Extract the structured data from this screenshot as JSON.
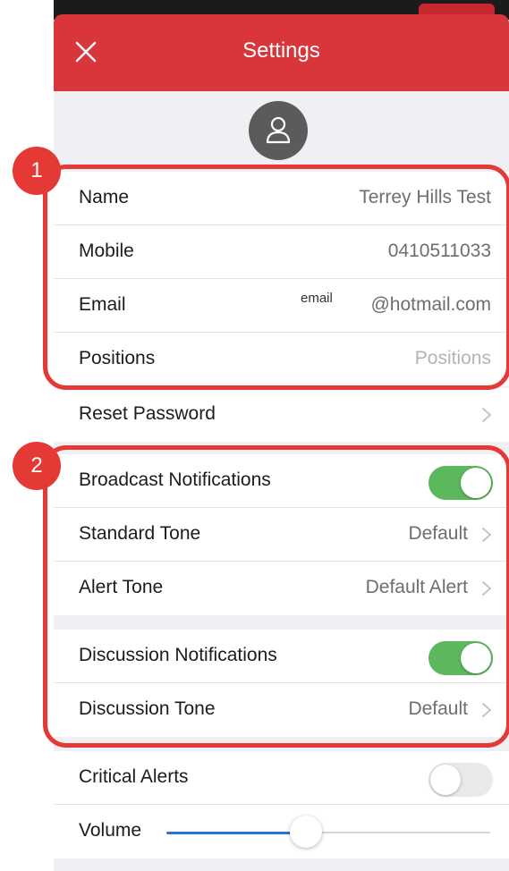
{
  "header": {
    "title": "Settings",
    "close_icon": "close-icon"
  },
  "profile": {
    "avatar_icon": "user-avatar-icon",
    "rows": [
      {
        "label": "Name",
        "value": "Terrey Hills Test"
      },
      {
        "label": "Mobile",
        "value": "0410511033"
      },
      {
        "label": "Email",
        "hint": "email",
        "value": "@hotmail.com"
      },
      {
        "label": "Positions",
        "placeholder": "Positions"
      }
    ]
  },
  "reset_password": {
    "label": "Reset Password"
  },
  "broadcast": {
    "notifications_label": "Broadcast Notifications",
    "notifications_on": true,
    "standard_tone_label": "Standard Tone",
    "standard_tone_value": "Default",
    "alert_tone_label": "Alert Tone",
    "alert_tone_value": "Default Alert"
  },
  "discussion": {
    "notifications_label": "Discussion Notifications",
    "notifications_on": true,
    "tone_label": "Discussion Tone",
    "tone_value": "Default"
  },
  "critical": {
    "critical_alerts_label": "Critical Alerts",
    "critical_alerts_on": false,
    "volume_label": "Volume",
    "volume_level": 0.43
  },
  "callouts": [
    "1",
    "2"
  ],
  "colors": {
    "nav_red": "#d8363b",
    "toggle_green": "#5cb85c",
    "slider_blue": "#2f6fe0",
    "callout_red": "#e53935"
  }
}
